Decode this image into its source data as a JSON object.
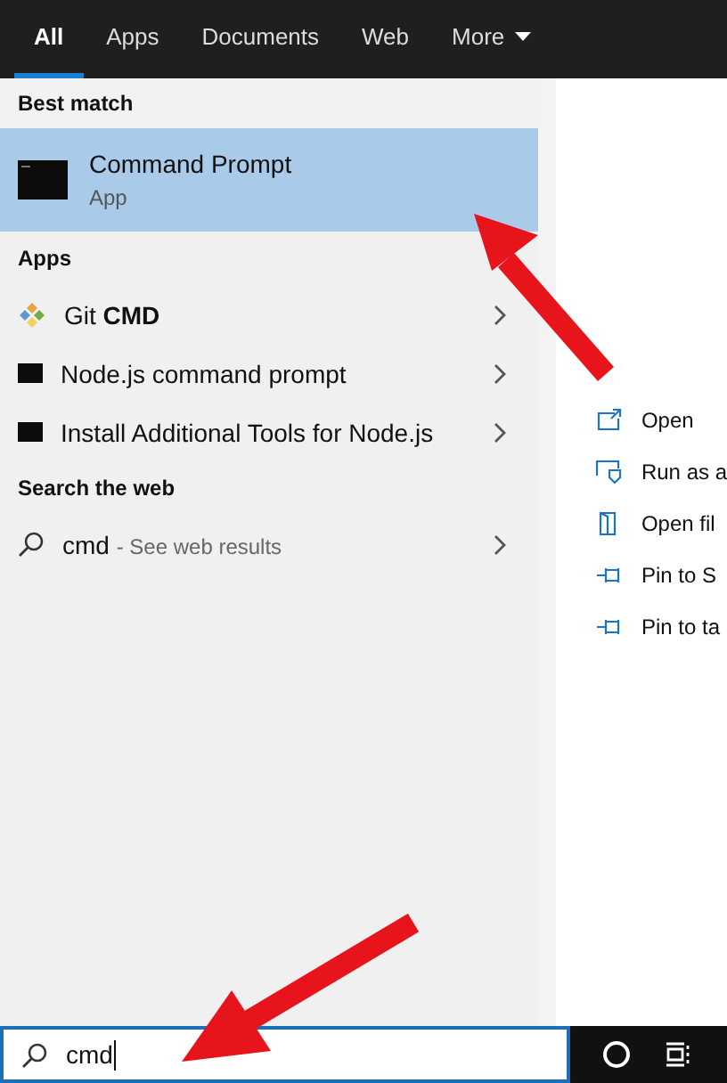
{
  "tabs": [
    {
      "label": "All",
      "selected": true
    },
    {
      "label": "Apps",
      "selected": false
    },
    {
      "label": "Documents",
      "selected": false
    },
    {
      "label": "Web",
      "selected": false
    },
    {
      "label": "More",
      "selected": false,
      "dropdown": true
    }
  ],
  "best_match": {
    "heading": "Best match",
    "title": "Command Prompt",
    "subtitle": "App",
    "selected": true
  },
  "apps": {
    "heading": "Apps",
    "items": [
      {
        "kind": "git",
        "label": "Git **CMD**"
      },
      {
        "kind": "console",
        "label": "Node.js command prompt"
      },
      {
        "kind": "console",
        "label": "Install Additional Tools for Node.js"
      }
    ]
  },
  "web": {
    "heading": "Search the web",
    "query": "cmd",
    "hint": "- See web results"
  },
  "actions": [
    {
      "kind": "open",
      "label": "Open"
    },
    {
      "kind": "admin",
      "label": "Run as a"
    },
    {
      "kind": "folder",
      "label": "Open fil"
    },
    {
      "kind": "pin",
      "label": "Pin to S"
    },
    {
      "kind": "pin",
      "label": "Pin to ta"
    }
  ],
  "search": {
    "value": "cmd"
  }
}
